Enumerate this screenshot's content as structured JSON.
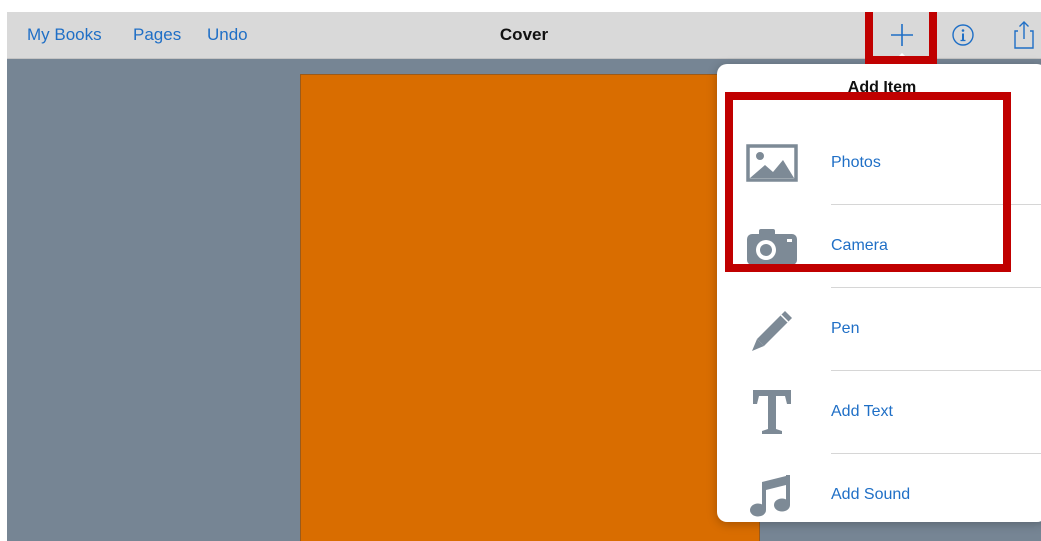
{
  "toolbar": {
    "my_books": "My Books",
    "pages": "Pages",
    "undo": "Undo",
    "title": "Cover",
    "icons": [
      "plus-icon",
      "info-icon",
      "share-icon"
    ]
  },
  "popover": {
    "title": "Add Item",
    "items": [
      {
        "label": "Photos",
        "icon": "photos-icon"
      },
      {
        "label": "Camera",
        "icon": "camera-icon"
      },
      {
        "label": "Pen",
        "icon": "pen-icon"
      },
      {
        "label": "Add Text",
        "icon": "text-icon"
      },
      {
        "label": "Add Sound",
        "icon": "music-note-icon"
      }
    ]
  },
  "colors": {
    "accent": "#1f6fc6",
    "cover_page": "#d96d00",
    "background": "#768594",
    "highlight": "#c00000"
  }
}
